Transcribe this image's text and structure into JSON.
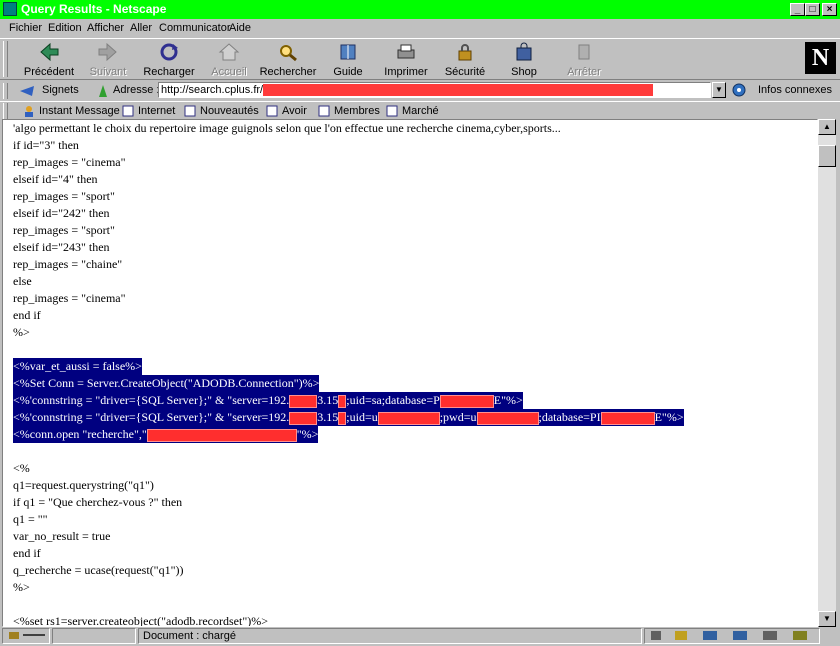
{
  "window": {
    "title": "Query Results - Netscape",
    "minimize": "_",
    "maximize": "□",
    "close": "×"
  },
  "menu": [
    "Fichier",
    "Edition",
    "Afficher",
    "Aller",
    "Communicator",
    "Aide"
  ],
  "toolbar": [
    {
      "label": "Précédent",
      "icon": "back-arrow-icon",
      "enabled": true
    },
    {
      "label": "Suivant",
      "icon": "forward-arrow-icon",
      "enabled": false
    },
    {
      "label": "Recharger",
      "icon": "reload-icon",
      "enabled": true
    },
    {
      "label": "Accueil",
      "icon": "home-icon",
      "enabled": false
    },
    {
      "label": "Rechercher",
      "icon": "search-icon",
      "enabled": true
    },
    {
      "label": "Guide",
      "icon": "guide-icon",
      "enabled": true
    },
    {
      "label": "Imprimer",
      "icon": "printer-icon",
      "enabled": true
    },
    {
      "label": "Sécurité",
      "icon": "padlock-icon",
      "enabled": true
    },
    {
      "label": "Shop",
      "icon": "shop-bag-icon",
      "enabled": true
    },
    {
      "label": "Arrêter",
      "icon": "stop-icon",
      "enabled": false
    }
  ],
  "logo": "N",
  "location": {
    "bookmarks_label": "Signets",
    "address_label": "Adresse :",
    "url": "http://search.cplus.fr/",
    "related_label": "Infos connexes"
  },
  "personal_toolbar": [
    "Instant Message",
    "Internet",
    "Nouveautés",
    "Avoir",
    "Membres",
    "Marché"
  ],
  "code_lines": [
    {
      "text": "'algo permettant le choix du repertoire image guignols selon que l'on effectue une recherche cinema,cyber,sports..."
    },
    {
      "text": "if id=\"3\" then"
    },
    {
      "text": "rep_images = \"cinema\""
    },
    {
      "text": "elseif id=\"4\" then"
    },
    {
      "text": "rep_images = \"sport\""
    },
    {
      "text": "elseif id=\"242\" then"
    },
    {
      "text": "rep_images = \"sport\""
    },
    {
      "text": "elseif id=\"243\" then"
    },
    {
      "text": "rep_images = \"chaine\""
    },
    {
      "text": "else"
    },
    {
      "text": "rep_images = \"cinema\""
    },
    {
      "text": "end if"
    },
    {
      "text": "%>"
    },
    {
      "text": ""
    },
    {
      "text": "<%var_et_aussi = false%>",
      "sel": true
    },
    {
      "text": "<%Set Conn = Server.CreateObject(\"ADODB.Connection\")%>",
      "sel": true
    },
    {
      "sel": true,
      "parts": [
        "<%'connstring = \"driver={SQL Server};\" & \"server=192.",
        {
          "r": 28
        },
        "3.15",
        {
          "r": 8
        },
        ";uid=sa;database=P",
        {
          "r": 54
        },
        "E\"%>"
      ]
    },
    {
      "sel": true,
      "parts": [
        "<%'connstring = \"driver={SQL Server};\" & \"server=192.",
        {
          "r": 28
        },
        "3.15",
        {
          "r": 8
        },
        ";uid=u",
        {
          "r": 62
        },
        ";pwd=u",
        {
          "r": 62
        },
        ";database=PI",
        {
          "r": 54
        },
        "E\"%>"
      ]
    },
    {
      "sel": true,
      "parts": [
        "<%conn.open \"recherche\",\"",
        {
          "r": 150
        },
        "\"%>"
      ]
    },
    {
      "text": ""
    },
    {
      "text": "<%"
    },
    {
      "text": "q1=request.querystring(\"q1\")"
    },
    {
      "text": "if q1 = \"Que cherchez-vous ?\" then"
    },
    {
      "text": "q1 = \"\""
    },
    {
      "text": "var_no_result = true"
    },
    {
      "text": "end if"
    },
    {
      "text": "q_recherche = ucase(request(\"q1\"))"
    },
    {
      "text": "%>"
    },
    {
      "text": ""
    },
    {
      "text": "<%set rs1=server.createobject(\"adodb.recordset\")%>"
    }
  ],
  "status": {
    "text": "Document : chargé"
  }
}
